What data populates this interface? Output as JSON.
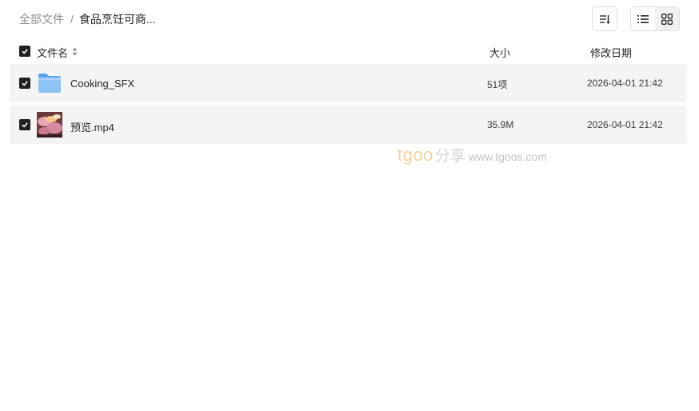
{
  "breadcrumb": {
    "root": "全部文件",
    "separator": "/",
    "current": "食品烹饪可商..."
  },
  "toolbar": {
    "sort_icon": "sort-icon",
    "list_view_icon": "list-view-icon",
    "grid_view_icon": "grid-view-icon"
  },
  "table": {
    "columns": {
      "name": "文件名",
      "size": "大小",
      "date": "修改日期"
    },
    "rows": [
      {
        "name": "Cooking_SFX",
        "type": "folder",
        "size": "51项",
        "date": "2026-04-01 21:42",
        "checked": true
      },
      {
        "name": "预览.mp4",
        "type": "video",
        "size": "35.9M",
        "date": "2026-04-01 21:42",
        "checked": true
      }
    ]
  },
  "watermark": {
    "brand": "tgoo",
    "share": "分享",
    "url": "www.tgoos.com"
  },
  "colors": {
    "accent_dark": "#1f2024",
    "row_bg": "#f4f4f5",
    "folder": "#7fb8f2",
    "watermark_brand": "#f6cf9e"
  }
}
